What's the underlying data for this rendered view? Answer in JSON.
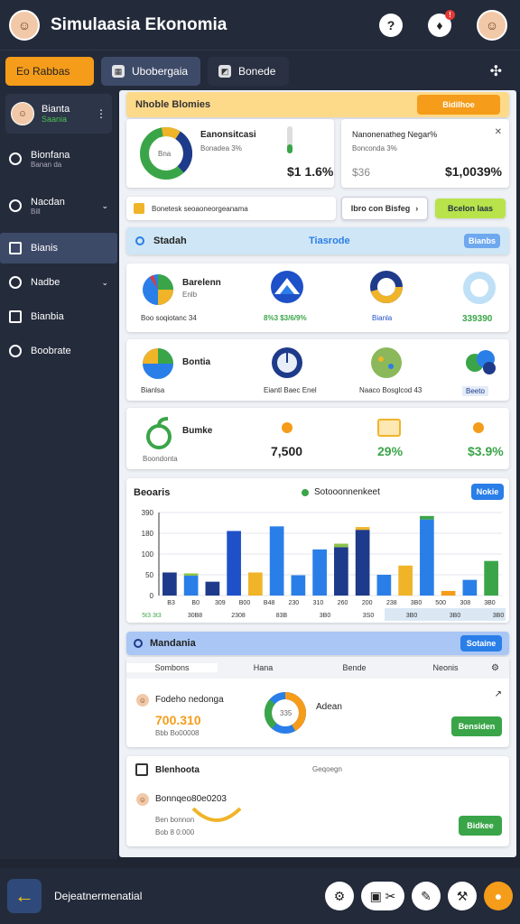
{
  "header": {
    "title": "Simulaasia Ekonomia",
    "help_icon": "?",
    "notif_count": "!"
  },
  "tabs": [
    {
      "label": "Eo   Rabbas"
    },
    {
      "label": "Ubobergaia"
    },
    {
      "label": "Bonede"
    }
  ],
  "sidebar": {
    "user": {
      "name": "Bianta",
      "status": "Saania"
    },
    "items": [
      {
        "label": "Bionfana",
        "sub": "Banan da"
      },
      {
        "label": "Nacdan",
        "sub": "Bill"
      },
      {
        "label": "Bianis"
      },
      {
        "label": "Nadbe"
      },
      {
        "label": "Bianbia"
      },
      {
        "label": "Boobrate"
      }
    ]
  },
  "banner": {
    "title": "Nhoble Blomies",
    "button": "Bidilhoe"
  },
  "summary": {
    "left": {
      "title": "Eanonsitcasi",
      "sub": "Bonadea 3%",
      "value": "$1 1.6%",
      "donut_center": "Bna"
    },
    "right": {
      "title": "Nanonenatheg Negar%",
      "sub": "Bonconda 3%",
      "value_small": "$36",
      "value": "$1,0039%"
    }
  },
  "action_row": {
    "field": "Bonetesk seoaoneorgeanama",
    "link": "Ibro con Bisfeg",
    "button": "Bcelon laas"
  },
  "section": {
    "title": "Stadah",
    "center": "Tiasrode",
    "button": "Bianbs"
  },
  "grid1": {
    "title": "Barelenn",
    "sub": "Enlb",
    "left_footer": "Boo soqiotanc 34",
    "c2": "8%3 $3/6/9%",
    "c3": "Bianla",
    "c4": "339390"
  },
  "grid2": {
    "title": "Bontia",
    "left_footer": "Bianlsa",
    "c2": "Eiantl Baec Enel",
    "c3": "Naaco Bosglcod 43",
    "c4": "Beeto"
  },
  "grid3": {
    "title": "Bumke",
    "sub": "Boondonta",
    "c2": "7,500",
    "c3": "29%",
    "c4": "$3.9%"
  },
  "chart_card": {
    "title": "Beoaris",
    "legend": "Sotooonnenkeet",
    "button": "Nokie"
  },
  "chart_data": {
    "type": "bar",
    "yticks": [
      "390",
      "180",
      "100",
      "50",
      "0"
    ],
    "xlabels": [
      "B3",
      "B0",
      "309",
      "B00",
      "B48",
      "230",
      "310",
      "260",
      "200",
      "238",
      "3B0",
      "500",
      "308",
      "3B0"
    ],
    "footer_labels": [
      "5t3 3t3",
      "30B8",
      "2308",
      "83B",
      "3B0",
      "3S0",
      "3B0",
      "3B0",
      "3B0"
    ],
    "bars": [
      {
        "value": 100,
        "color": "#1e3a8a"
      },
      {
        "value": 86,
        "color": "#2a7ee8",
        "top": 10,
        "topColor": "#8bc34a"
      },
      {
        "value": 60,
        "color": "#1e3a8a"
      },
      {
        "value": 280,
        "color": "#1e50c8"
      },
      {
        "value": 100,
        "color": "#f0b429"
      },
      {
        "value": 300,
        "color": "#2a7ee8"
      },
      {
        "value": 88,
        "color": "#2a7ee8"
      },
      {
        "value": 200,
        "color": "#2a7ee8"
      },
      {
        "value": 210,
        "color": "#1e3a8a",
        "top": 15,
        "topColor": "#8bc34a"
      },
      {
        "value": 285,
        "color": "#1e3a8a",
        "top": 12,
        "topColor": "#f0b429"
      },
      {
        "value": 90,
        "color": "#2a7ee8"
      },
      {
        "value": 130,
        "color": "#f0b429"
      },
      {
        "value": 330,
        "color": "#2a7ee8",
        "top": 15,
        "topColor": "#3aa548"
      },
      {
        "value": 20,
        "color": "#f59c1a"
      },
      {
        "value": 68,
        "color": "#2a7ee8"
      },
      {
        "value": 150,
        "color": "#3aa548"
      }
    ],
    "ylim": [
      0,
      360
    ]
  },
  "market": {
    "title": "Mandania",
    "button": "Sotaine",
    "tabs": [
      "Sombons",
      "Hana",
      "Bende",
      "Neonis"
    ],
    "row1": {
      "name": "Fodeho nedonga",
      "value": "700.310",
      "sub": "Bbb  Bo00008",
      "mid": "Adean",
      "donut": "335",
      "button": "Bensiden"
    },
    "row2": {
      "title": "Blenhoota",
      "right": "Geqoegn",
      "name": "Bonnqeo80e0203",
      "sub": "Ben bonnon",
      "sub2": "Bob 8 0:000",
      "button": "Bidkee"
    }
  },
  "bottom": {
    "label": "Dejeatnermenatial"
  }
}
